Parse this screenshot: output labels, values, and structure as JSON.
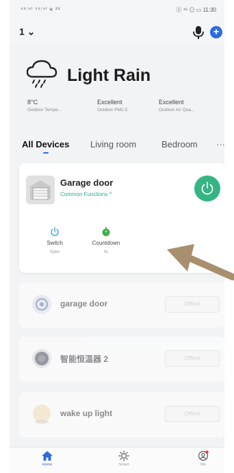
{
  "status_bar": {
    "left": "⁴⁶⫶ⁿˡ ⁴⁶⫶ⁿˡ ≋ ²²",
    "right": "ⓢ ⁴⁶ ◎ ▭ 11:30"
  },
  "header": {
    "home_selector": "1 ⌄"
  },
  "weather": {
    "condition": "Light Rain",
    "stats": [
      {
        "value": "8°C",
        "label": "Outdoor Tempe..."
      },
      {
        "value": "Excellent",
        "label": "Outdoor PM2.5"
      },
      {
        "value": "Excellent",
        "label": "Outdoor Air Qua..."
      }
    ]
  },
  "tabs": [
    "All Devices",
    "Living room",
    "Bedroom"
  ],
  "tabs_more": "···",
  "main_device": {
    "name": "Garage door",
    "subtitle": "Common Functions ^",
    "functions": [
      {
        "name": "Switch",
        "value": "Open",
        "icon": "power-icon"
      },
      {
        "name": "Countdown",
        "value": "0s",
        "icon": "timer-icon"
      }
    ]
  },
  "offline_devices": [
    {
      "name": "garage door",
      "status": "Offline",
      "icon": "device-ring-icon"
    },
    {
      "name": "智能恒温器 2",
      "status": "Offline",
      "icon": "thermostat-icon"
    },
    {
      "name": "wake up light",
      "status": "Offline",
      "icon": "light-icon"
    }
  ],
  "bottom_nav": [
    {
      "label": "Home",
      "icon": "home-icon",
      "active": true
    },
    {
      "label": "Smart",
      "icon": "sun-icon",
      "active": false
    },
    {
      "label": "Me",
      "icon": "profile-icon",
      "active": false
    }
  ],
  "colors": {
    "accent": "#2d6bdc",
    "power_green": "#35b583",
    "function_text": "#2fa58b",
    "annotation_arrow": "#a88f6e"
  }
}
